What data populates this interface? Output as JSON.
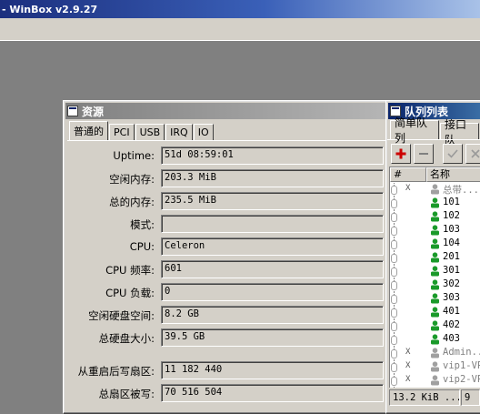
{
  "app": {
    "title": "- WinBox v2.9.27"
  },
  "resources_window": {
    "title": "资源",
    "tabs": [
      "普通的",
      "PCI",
      "USB",
      "IRQ",
      "IO"
    ],
    "fields": [
      {
        "label": "Uptime:",
        "value": "51d 08:59:01"
      },
      {
        "label": "空闲内存:",
        "value": "203.3 MiB"
      },
      {
        "label": "总的内存:",
        "value": "235.5 MiB"
      },
      {
        "label": "模式:",
        "value": ""
      },
      {
        "label": "CPU:",
        "value": "Celeron"
      },
      {
        "label": "CPU 频率:",
        "value": "601"
      },
      {
        "label": "CPU 负载:",
        "value": "0"
      },
      {
        "label": "空闲硬盘空间:",
        "value": "8.2 GB"
      },
      {
        "label": "总硬盘大小:",
        "value": "39.5 GB"
      },
      {
        "label": "从重启后写扇区:",
        "value": "11 182 440"
      },
      {
        "label": "总扇区被写:",
        "value": "70 516 504"
      }
    ]
  },
  "queue_window": {
    "title": "队列列表",
    "tabs": [
      "简单队列",
      "接口队"
    ],
    "columns": [
      "#",
      "名称"
    ],
    "rows": [
      {
        "flag": "X",
        "name": "总带...",
        "disabled": true,
        "icon": "gray"
      },
      {
        "flag": "",
        "name": "101",
        "disabled": false,
        "icon": "green"
      },
      {
        "flag": "",
        "name": "102",
        "disabled": false,
        "icon": "green"
      },
      {
        "flag": "",
        "name": "103",
        "disabled": false,
        "icon": "green"
      },
      {
        "flag": "",
        "name": "104",
        "disabled": false,
        "icon": "green"
      },
      {
        "flag": "",
        "name": "201",
        "disabled": false,
        "icon": "green"
      },
      {
        "flag": "",
        "name": "301",
        "disabled": false,
        "icon": "green"
      },
      {
        "flag": "",
        "name": "302",
        "disabled": false,
        "icon": "green"
      },
      {
        "flag": "",
        "name": "303",
        "disabled": false,
        "icon": "green"
      },
      {
        "flag": "",
        "name": "401",
        "disabled": false,
        "icon": "green"
      },
      {
        "flag": "",
        "name": "402",
        "disabled": false,
        "icon": "green"
      },
      {
        "flag": "",
        "name": "403",
        "disabled": false,
        "icon": "green"
      },
      {
        "flag": "X",
        "name": "Admin...",
        "disabled": true,
        "icon": "gray"
      },
      {
        "flag": "X",
        "name": "vip1-VP",
        "disabled": true,
        "icon": "gray"
      },
      {
        "flag": "X",
        "name": "vip2-VP",
        "disabled": true,
        "icon": "gray"
      }
    ],
    "status": {
      "rate": "13.2 KiB ...",
      "count": "9 "
    }
  },
  "colors": {
    "active_title": "#0a246a",
    "inactive_title": "#808080",
    "add_red": "#cc0000",
    "queue_green": "#1a9a2a"
  }
}
